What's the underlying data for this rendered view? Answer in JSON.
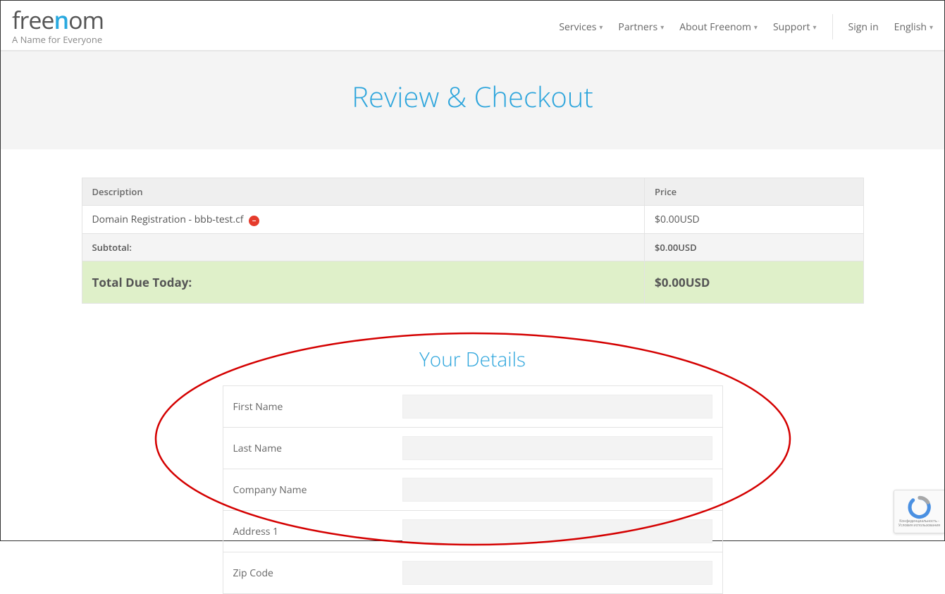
{
  "brand": {
    "part1": "free",
    "part2": "n",
    "part3": "om",
    "tagline": "A Name for Everyone"
  },
  "nav": {
    "services": "Services",
    "partners": "Partners",
    "about": "About Freenom",
    "support": "Support",
    "signin": "Sign in",
    "language": "English"
  },
  "page": {
    "title": "Review & Checkout"
  },
  "cart": {
    "headers": {
      "description": "Description",
      "price": "Price"
    },
    "items": [
      {
        "description": "Domain Registration - bbb-test.cf",
        "price": "$0.00USD"
      }
    ],
    "subtotal": {
      "label": "Subtotal:",
      "value": "$0.00USD"
    },
    "total": {
      "label": "Total Due Today:",
      "value": "$0.00USD"
    }
  },
  "details": {
    "title": "Your Details",
    "fields": {
      "first_name": "First Name",
      "last_name": "Last Name",
      "company": "Company Name",
      "address1": "Address 1",
      "zip": "Zip Code"
    }
  },
  "recaptcha": {
    "line1": "Конфиденциальность -",
    "line2": "Условия использования"
  }
}
